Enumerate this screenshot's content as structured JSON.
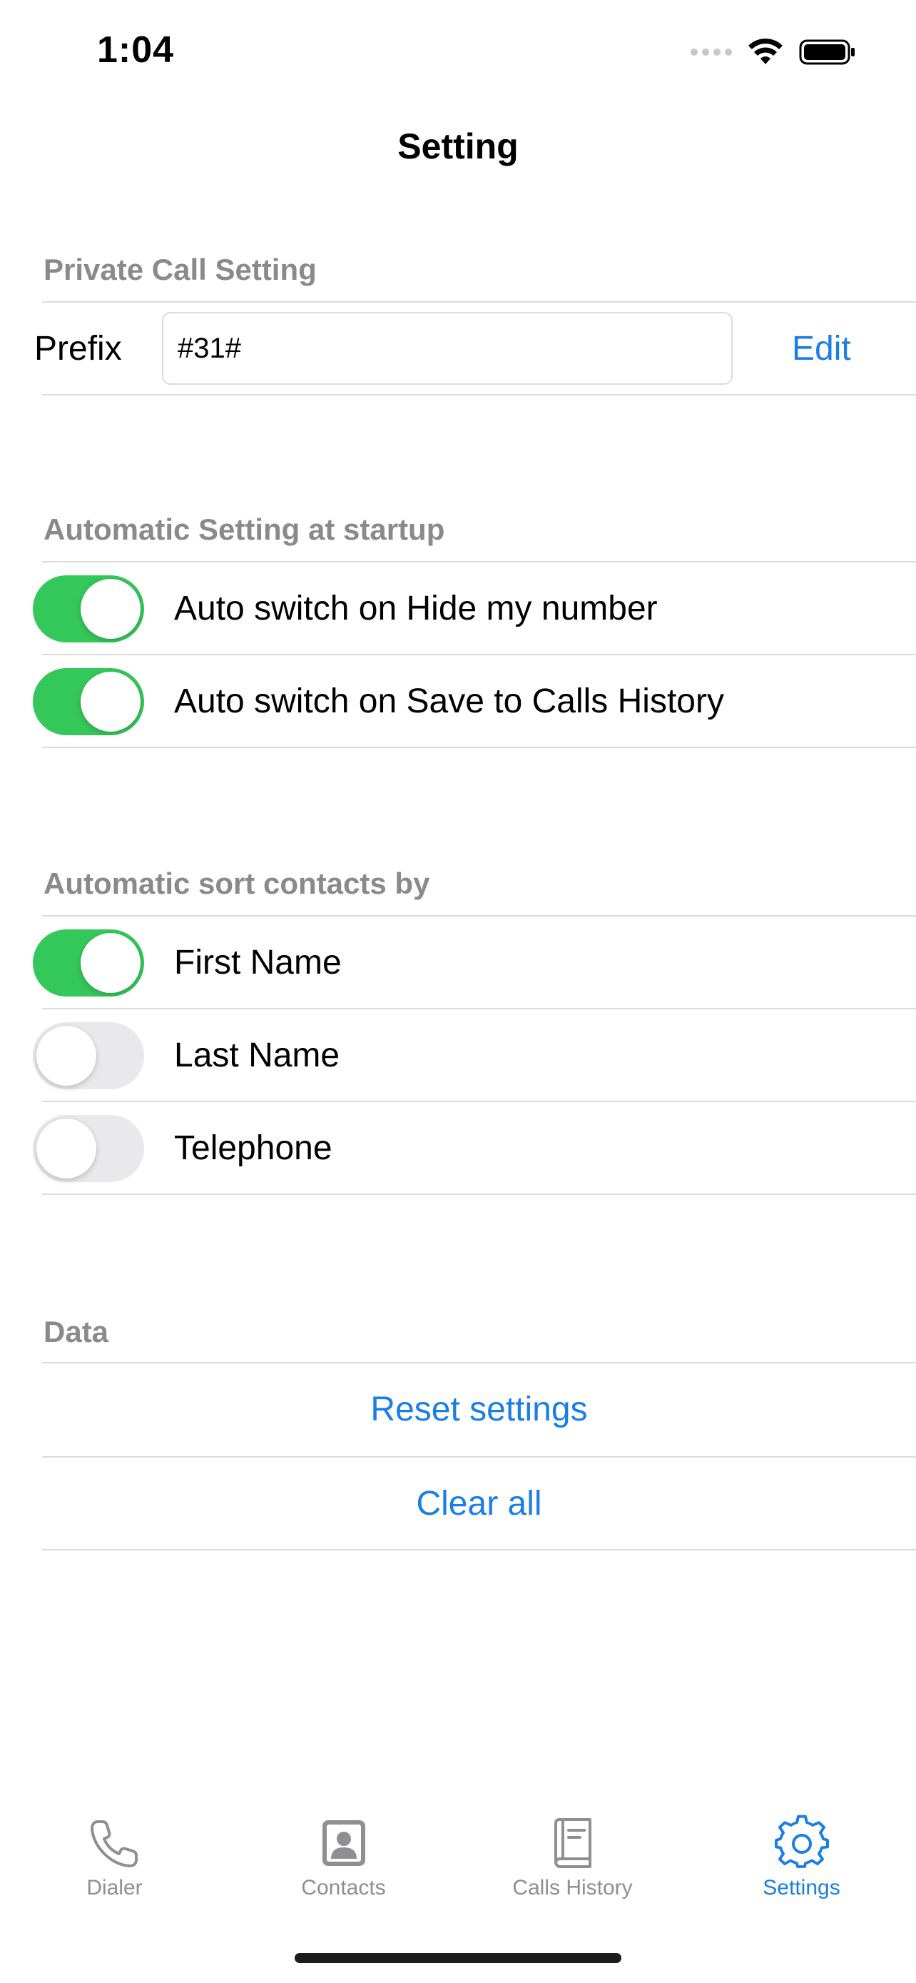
{
  "status_bar": {
    "time": "1:04"
  },
  "nav": {
    "title": "Setting"
  },
  "private_call": {
    "header": "Private Call Setting",
    "prefix_label": "Prefix",
    "prefix_value": "#31#",
    "edit_label": "Edit"
  },
  "startup": {
    "header": "Automatic Setting at startup",
    "items": [
      {
        "label": "Auto switch on Hide my number",
        "on": true
      },
      {
        "label": "Auto switch on Save to Calls History",
        "on": true
      }
    ]
  },
  "sort": {
    "header": "Automatic sort contacts by",
    "items": [
      {
        "label": "First Name",
        "on": true
      },
      {
        "label": "Last Name",
        "on": false
      },
      {
        "label": "Telephone",
        "on": false
      }
    ]
  },
  "data_section": {
    "header": "Data",
    "reset_label": "Reset settings",
    "clear_label": "Clear all"
  },
  "tabbar": {
    "tabs": [
      {
        "label": "Dialer",
        "icon": "phone-icon",
        "active": false
      },
      {
        "label": "Contacts",
        "icon": "contact-card-icon",
        "active": false
      },
      {
        "label": "Calls History",
        "icon": "book-icon",
        "active": false
      },
      {
        "label": "Settings",
        "icon": "gear-icon",
        "active": true
      }
    ]
  },
  "colors": {
    "accent": "#1a7ee6",
    "toggle_on": "#34c759",
    "toggle_off": "#e9e9eb",
    "section_header": "#8a8a8e",
    "inactive_tab": "#8e8e93"
  }
}
